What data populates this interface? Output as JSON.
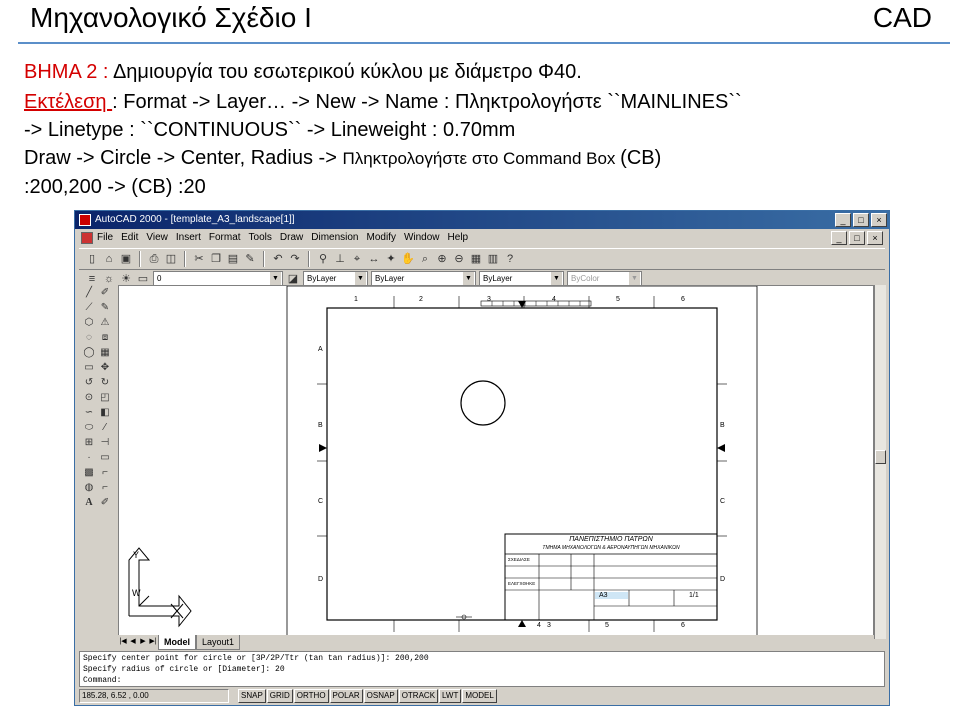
{
  "slide": {
    "title": "Μηχανολογικό Σχέδιο Ι",
    "tag": "CAD",
    "step_label": "ΒΗΜΑ 2 :",
    "step_text": " Δημιουργία του εσωτερικού κύκλου με διάμετρο Φ40.",
    "exec_label": "Εκτέλεση ",
    "exec_text": ": Format -> Layer… -> New -> Name : Πληκτρολογήστε ``MAINLINES``",
    "line3": "-> Linetype : ``CONTINUOUS`` -> Lineweight : 0.70mm",
    "line4a": "Draw -> Circle -> Center, Radius -> ",
    "line4b": "Πληκτρολογήστε στο Command Box ",
    "line4c": "(CB)",
    "line5": ":200,200 -> (CB) :20"
  },
  "window": {
    "title": "AutoCAD 2000 - [template_A3_landscape[1]]",
    "min": "_",
    "max": "□",
    "close": "×",
    "menu": [
      "File",
      "Edit",
      "View",
      "Insert",
      "Format",
      "Tools",
      "Draw",
      "Dimension",
      "Modify",
      "Window",
      "Help"
    ]
  },
  "props": {
    "layer": "0",
    "color": "ByLayer",
    "linetype": "ByLayer",
    "lineweight": "ByLayer",
    "plotstyle": "ByColor"
  },
  "drawing": {
    "top_numbers": [
      "1",
      "2",
      "3",
      "4",
      "5",
      "6"
    ],
    "bottom_numbers": [
      "3",
      "4",
      "5",
      "6"
    ],
    "side_letters_left": [
      "A",
      "B",
      "C",
      "D"
    ],
    "side_letters_right": [
      "B",
      "C",
      "D"
    ],
    "title_block": {
      "university": "ΠΑΝΕΠΙΣΤΗΜΙΟ ΠΑΤΡΩΝ",
      "dept": "ΤΜΗΜΑ ΜΗΧΑΝΟΛΟΓΩΝ & ΑΕΡΟΝΑΥΠΗΓΩΝ ΜΗΧΑΝΙΚΩΝ",
      "row1": "ΣΧΕΔΙΑΣΕ",
      "row2": "ΕΛΕΓΧΘΗΚΕ",
      "size": "A3",
      "scale": "1/1"
    },
    "ucs_y": "Y",
    "ucs_w": "W"
  },
  "tabs": [
    "Model",
    "Layout1"
  ],
  "command": {
    "lines": [
      "Specify center point for circle or [3P/2P/Ttr (tan tan radius)]: 200,200",
      "Specify radius of circle or [Diameter]: 20",
      "Command:"
    ]
  },
  "status": {
    "coords": "185.28, 6.52 , 0.00",
    "buttons": [
      "SNAP",
      "GRID",
      "ORTHO",
      "POLAR",
      "OSNAP",
      "OTRACK",
      "LWT",
      "MODEL"
    ]
  }
}
